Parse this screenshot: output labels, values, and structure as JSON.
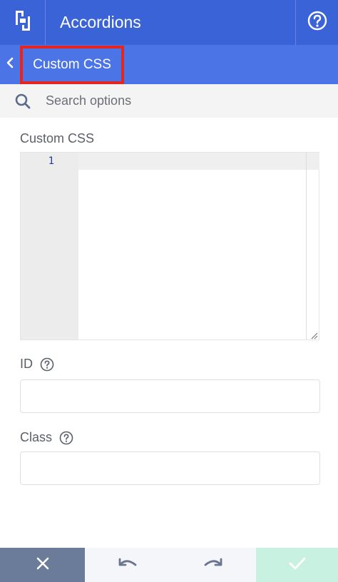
{
  "header": {
    "title": "Accordions",
    "logo_icon": "builder-logo-icon",
    "help_icon": "question-circle-icon",
    "background": "#3a63d8"
  },
  "breadcrumb": {
    "current": "Custom CSS",
    "back_icon": "chevron-left-icon",
    "background": "#4b74e6",
    "highlight_color": "#e5251f"
  },
  "search": {
    "placeholder": "Search options",
    "value": ""
  },
  "custom_css": {
    "label": "Custom CSS",
    "line_numbers": [
      "1"
    ],
    "content": ""
  },
  "id_field": {
    "label": "ID",
    "value": "",
    "help_icon": "question-circle-icon"
  },
  "class_field": {
    "label": "Class",
    "value": "",
    "help_icon": "question-circle-icon"
  },
  "toolbar": {
    "close_icon": "close-icon",
    "undo_icon": "undo-icon",
    "redo_icon": "redo-icon",
    "save_icon": "checkmark-icon"
  }
}
